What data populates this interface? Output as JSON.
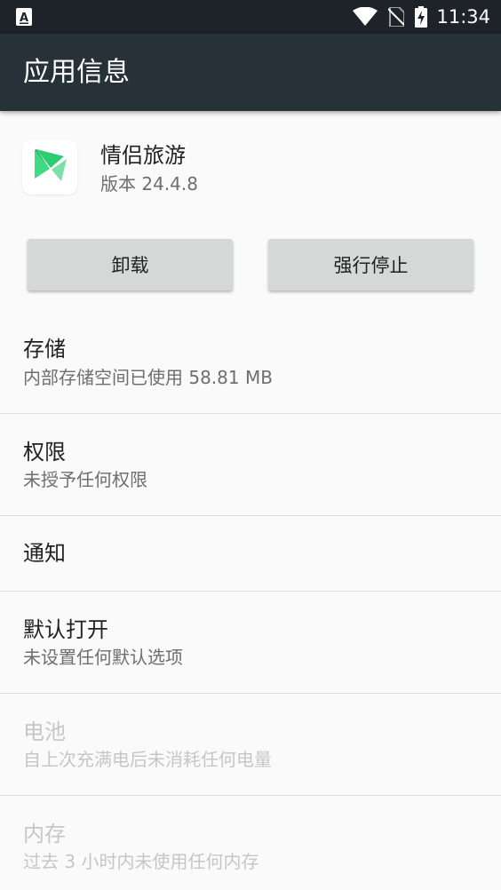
{
  "status_bar": {
    "time": "11:34",
    "icons": [
      "notification-a-icon",
      "wifi-icon",
      "no-sim-icon",
      "battery-charging-icon"
    ]
  },
  "toolbar": {
    "title": "应用信息"
  },
  "app": {
    "name": "情侣旅游",
    "version": "版本 24.4.8"
  },
  "buttons": {
    "uninstall": "卸载",
    "force_stop": "强行停止"
  },
  "items": [
    {
      "title": "存储",
      "subtitle": "内部存储空间已使用 58.81 MB",
      "enabled": true
    },
    {
      "title": "权限",
      "subtitle": "未授予任何权限",
      "enabled": true
    },
    {
      "title": "通知",
      "subtitle": "",
      "enabled": true
    },
    {
      "title": "默认打开",
      "subtitle": "未设置任何默认选项",
      "enabled": true
    },
    {
      "title": "电池",
      "subtitle": "自上次充满电后未消耗任何电量",
      "enabled": false
    },
    {
      "title": "内存",
      "subtitle": "过去 3 小时内未使用任何内存",
      "enabled": false
    }
  ],
  "colors": {
    "status_bar": "#1d2328",
    "toolbar": "#263238",
    "app_icon_green": "#3ddc84",
    "disabled_text": "#c6c6c6"
  }
}
